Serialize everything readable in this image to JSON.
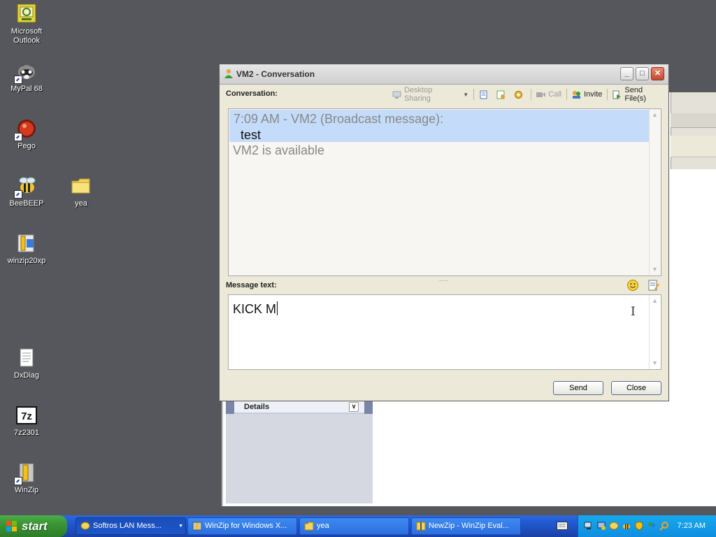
{
  "desktop": {
    "icons": [
      {
        "label_line1": "Microsoft",
        "label_line2": "Outlook"
      },
      {
        "label": "MyPal 68"
      },
      {
        "label": "Pego"
      },
      {
        "label": "BeeBEEP"
      },
      {
        "label": "yea"
      },
      {
        "label": "winzip20xp"
      },
      {
        "label": "DxDiag"
      },
      {
        "label": "7z2301"
      },
      {
        "label": "WinZip"
      }
    ]
  },
  "background_window": {
    "details_label": "Details"
  },
  "conversation_window": {
    "title": "VM2 - Conversation",
    "conversation_label": "Conversation:",
    "toolbar": {
      "desktop_sharing": "Desktop Sharing",
      "call": "Call",
      "invite": "Invite",
      "send_files": "Send File(s)"
    },
    "log": {
      "message_header": "7:09 AM - VM2 (Broadcast message):",
      "message_body": "test",
      "status": "VM2 is available"
    },
    "message_label": "Message text:",
    "input_value": "KICK M",
    "send_label": "Send",
    "close_label": "Close"
  },
  "taskbar": {
    "start_label": "start",
    "tasks": [
      {
        "label": "Softros LAN Mess..."
      },
      {
        "label": "WinZip for Windows X..."
      },
      {
        "label": "yea"
      },
      {
        "label": "NewZip - WinZip Eval..."
      }
    ],
    "clock": "7:23 AM"
  },
  "colors": {
    "desktop": "#56575d",
    "taskbar_blue": "#245edb",
    "start_green": "#3b9435",
    "tray_blue": "#0f8ee0",
    "selection_blue": "#c4dcf9"
  }
}
